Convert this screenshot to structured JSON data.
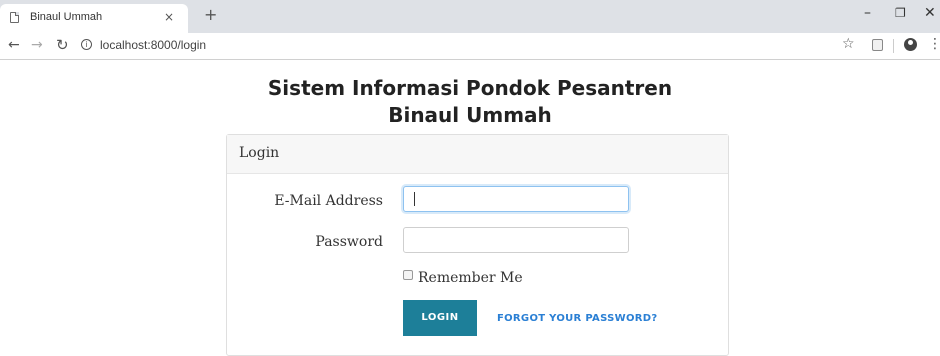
{
  "browser": {
    "tab_title": "Binaul Ummah",
    "tab_close": "×",
    "new_tab": "+",
    "address": "localhost:8000/login",
    "icons": [
      "page-icon",
      "back-arrow-icon",
      "forward-arrow-icon",
      "reload-icon",
      "info-icon",
      "star-icon",
      "extension-icon",
      "account-icon",
      "menu-dots-icon",
      "minimize-icon",
      "maximize-icon",
      "close-icon"
    ]
  },
  "page": {
    "title_line1": "Sistem Informasi Pondok Pesantren",
    "title_line2": "Binaul Ummah"
  },
  "login_card": {
    "header": "Login",
    "email_label": "E-Mail Address",
    "email_value": "",
    "password_label": "Password",
    "password_value": "",
    "remember_label": "Remember Me",
    "remember_checked": false,
    "login_button": "LOGIN",
    "forgot_link": "FORGOT YOUR PASSWORD?"
  },
  "colors": {
    "button_bg": "#1d7f99",
    "link": "#2a7fd4",
    "focus_border": "#8ec2f0"
  }
}
